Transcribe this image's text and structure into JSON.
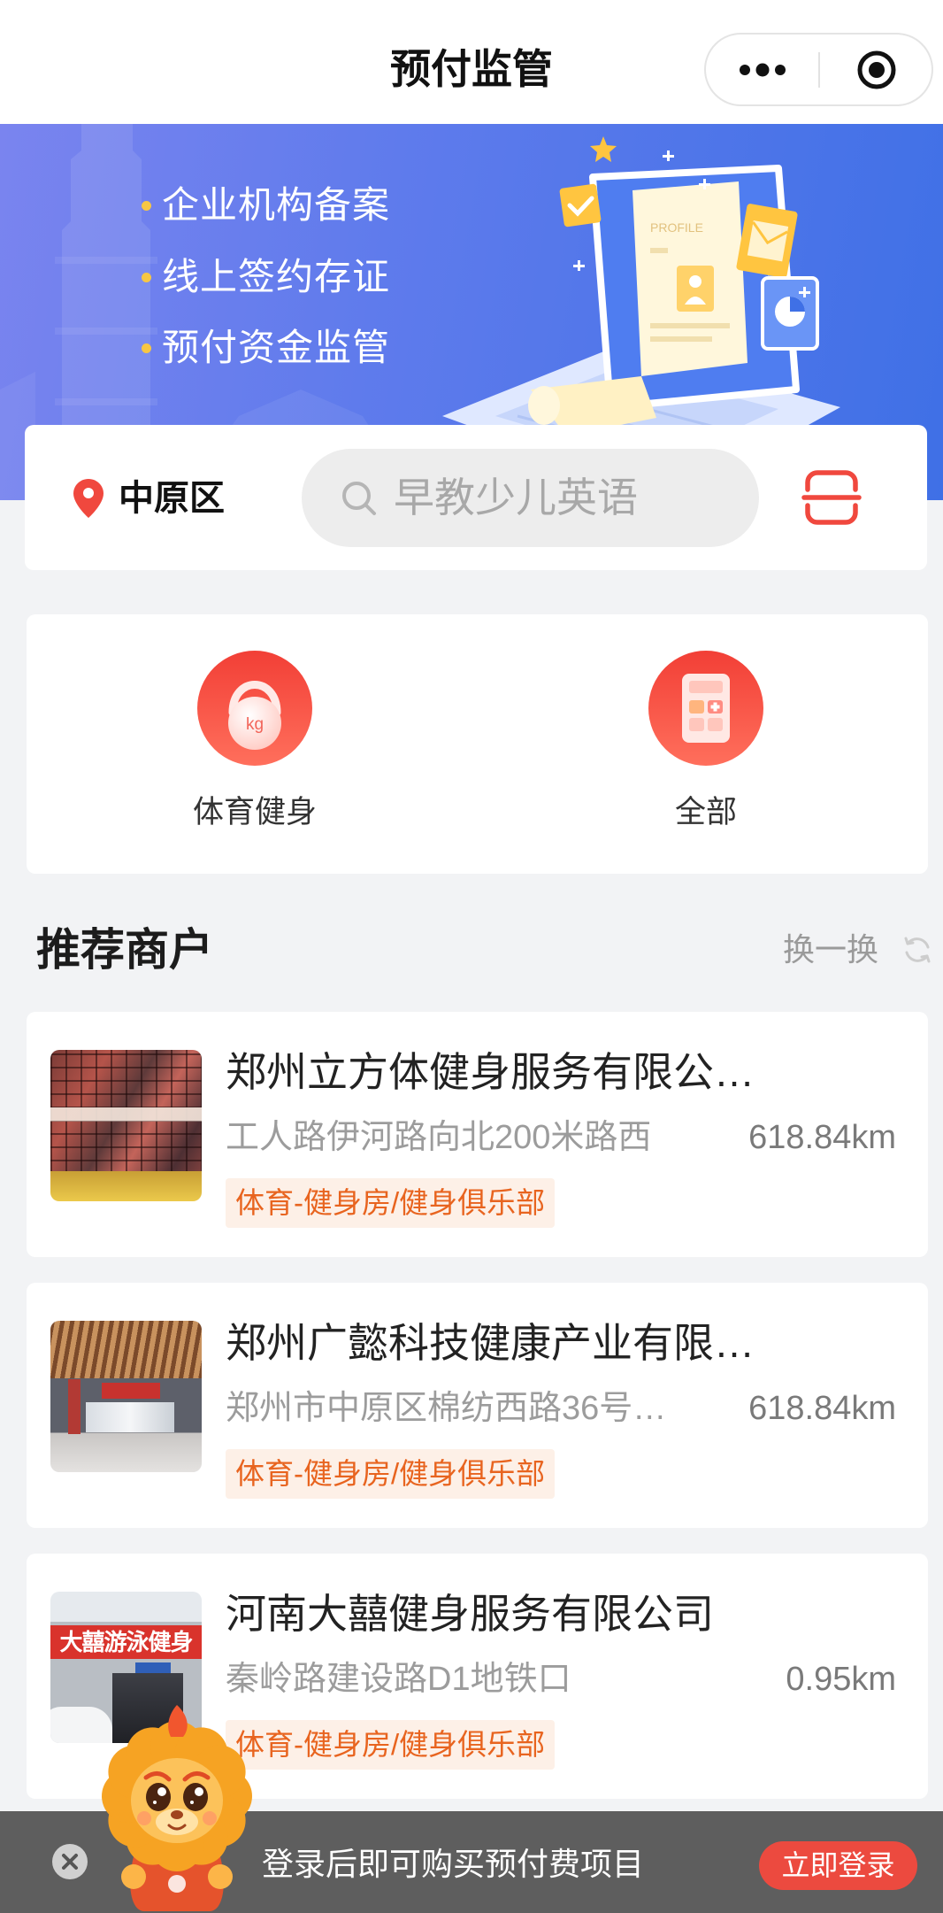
{
  "header": {
    "title": "预付监管",
    "more_icon": "more-dots-icon",
    "exit_icon": "target-circle-icon"
  },
  "banner": {
    "bullets": [
      {
        "text": "企业机构备案"
      },
      {
        "text": "线上签约存证"
      },
      {
        "text": "预付资金监管"
      }
    ],
    "illustration_label": "PROFILE"
  },
  "search": {
    "location": "中原区",
    "location_icon": "location-pin-icon",
    "placeholder": "早教少儿英语",
    "search_icon": "search-icon",
    "scan_icon": "scan-icon"
  },
  "categories": [
    {
      "label": "体育健身",
      "icon": "kettlebell-icon",
      "icon_text": "kg"
    },
    {
      "label": "全部",
      "icon": "calculator-icon"
    }
  ],
  "recommend": {
    "title": "推荐商户",
    "refresh_label": "换一换",
    "refresh_icon": "refresh-icon"
  },
  "merchants": [
    {
      "name": "郑州立方体健身服务有限公…",
      "address": "工人路伊河路向北200米路西",
      "distance": "618.84km",
      "tag": "体育-健身房/健身俱乐部"
    },
    {
      "name": "郑州广懿科技健康产业有限…",
      "address": "郑州市中原区棉纺西路36号…",
      "distance": "618.84km",
      "tag": "体育-健身房/健身俱乐部"
    },
    {
      "name": "河南大囍健身服务有限公司",
      "address": "秦岭路建设路D1地铁口",
      "distance": "0.95km",
      "tag": "体育-健身房/健身俱乐部",
      "photo_sign": "大囍游泳健身"
    }
  ],
  "login_bar": {
    "message": "登录后即可购买预付费项目",
    "button_label": "立即登录",
    "close_icon": "close-circle-icon",
    "mascot_icon": "lion-mascot-icon"
  },
  "colors": {
    "brand_red": "#ec4a3f",
    "banner_blue": "#3f70e6",
    "tag_text": "#e8641f",
    "tag_bg": "#fdf0e7",
    "page_bg": "#f2f3f5",
    "bullet_dot": "#f7c744"
  }
}
